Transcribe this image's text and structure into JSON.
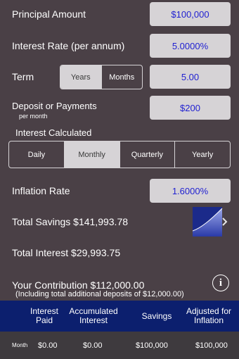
{
  "principal": {
    "label": "Principal Amount",
    "value": "$100,000"
  },
  "interest_rate": {
    "label": "Interest Rate (per annum)",
    "value": "5.0000%"
  },
  "term": {
    "label": "Term",
    "options": [
      "Years",
      "Months"
    ],
    "selected": "Years",
    "value": "5.00"
  },
  "deposit": {
    "label": "Deposit or Payments",
    "sublabel": "per month",
    "value": "$200"
  },
  "interest_calc": {
    "label": "Interest Calculated",
    "options": [
      "Daily",
      "Monthly",
      "Quarterly",
      "Yearly"
    ],
    "selected": "Monthly"
  },
  "inflation": {
    "label": "Inflation Rate",
    "value": "1.6000%"
  },
  "total_savings": "Total Savings $141,993.78",
  "total_interest": "Total Interest $29,993.75",
  "contribution": {
    "line1": "Your Contribution $112,000.00",
    "line2": "(Including total additional deposits of $12,000.00)"
  },
  "table": {
    "headers": [
      "Interest Paid",
      "Accumulated Interest",
      "Savings",
      "Adjusted for Inflation"
    ],
    "row": {
      "period": "Month",
      "values": [
        "$0.00",
        "$0.00",
        "$100,000",
        "$100,000"
      ]
    }
  },
  "colors": {
    "accent": "#1f1fd1",
    "header_bg": "#0c1f6e",
    "background": "#4a4046"
  }
}
